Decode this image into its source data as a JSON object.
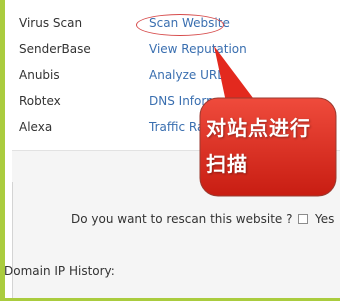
{
  "tools": [
    {
      "name": "Virus Scan",
      "action": "Scan Website"
    },
    {
      "name": "SenderBase",
      "action": "View Reputation"
    },
    {
      "name": "Anubis",
      "action": "Analyze URL"
    },
    {
      "name": "Robtex",
      "action": "DNS Information"
    },
    {
      "name": "Alexa",
      "action": "Traffic Rank"
    }
  ],
  "rescan": {
    "question": "Do you want to rescan this website ?",
    "option_label": "Yes"
  },
  "history": {
    "label": "Domain IP History:"
  },
  "annotation": {
    "line1": "对站点进行",
    "line2": "扫描",
    "color": "#e3291e"
  },
  "colors": {
    "link": "#3a6fb0",
    "frame": "#aacc3e"
  }
}
